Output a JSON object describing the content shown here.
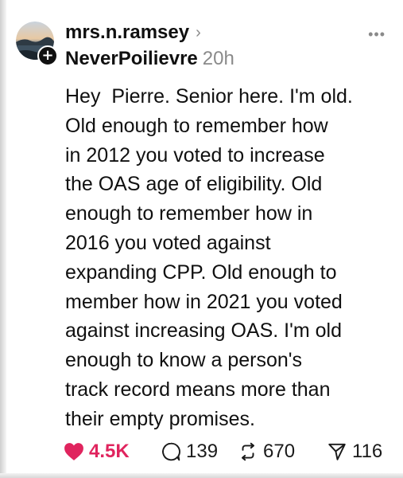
{
  "post": {
    "username": "mrs.n.ramsey",
    "tag": "NeverPoilievre",
    "time": "20h",
    "text": "Hey  Pierre. Senior here. I'm old.\nOld enough to remember how\nin 2012 you voted to increase\nthe OAS age of eligibility. Old\nenough to remember how in\n2016 you voted against\nexpanding CPP. Old enough to\nmember how in 2021 you voted\nagainst increasing OAS. I'm old\nenough to know a person's\ntrack record means more than\ntheir empty promises."
  },
  "actions": {
    "likes": "4.5K",
    "replies": "139",
    "reposts": "670",
    "shares": "116"
  },
  "icons": {
    "more": "more-horizontal-icon",
    "like": "heart-icon",
    "reply": "speech-bubble-icon",
    "repost": "repost-icon",
    "share": "send-icon",
    "follow": "plus-icon"
  },
  "colors": {
    "like": "#e0245e",
    "muted": "#8a8a8a",
    "text": "#101010"
  }
}
